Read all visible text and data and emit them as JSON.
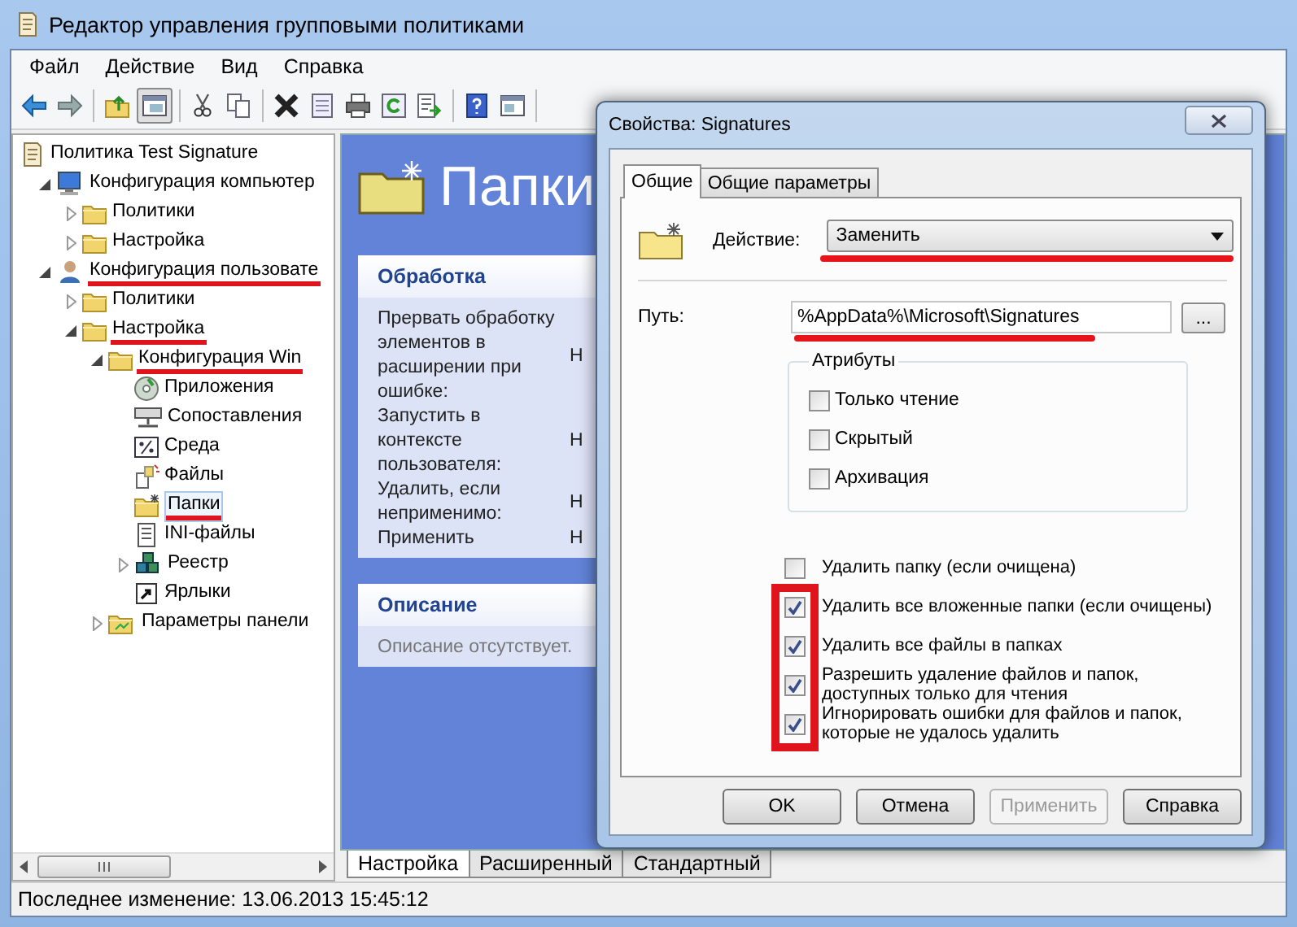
{
  "window": {
    "title": "Редактор управления групповыми политиками"
  },
  "menu": [
    {
      "label": "Файл"
    },
    {
      "label": "Действие"
    },
    {
      "label": "Вид"
    },
    {
      "label": "Справка"
    }
  ],
  "tree": {
    "label": "Политика Test Signature",
    "kind": "policy",
    "selected": false,
    "highlighted": false,
    "children": [
      {
        "label": "Конфигурация компьютер",
        "kind": "computer",
        "expanded": true,
        "selected": false,
        "highlighted": false,
        "children": [
          {
            "label": "Политики",
            "kind": "folder",
            "expanded": false,
            "selected": false,
            "highlighted": false
          },
          {
            "label": "Настройка",
            "kind": "folder",
            "expanded": false,
            "selected": false,
            "highlighted": false
          }
        ]
      },
      {
        "label": "Конфигурация пользовате",
        "kind": "user",
        "expanded": true,
        "selected": false,
        "highlighted": true,
        "children": [
          {
            "label": "Политики",
            "kind": "folder",
            "expanded": false,
            "selected": false,
            "highlighted": false
          },
          {
            "label": "Настройка",
            "kind": "folder",
            "expanded": true,
            "selected": false,
            "highlighted": true,
            "children": [
              {
                "label": "Конфигурация Win",
                "kind": "folder",
                "expanded": true,
                "selected": false,
                "highlighted": true,
                "children": [
                  {
                    "label": "Приложения",
                    "kind": "apps",
                    "selected": false,
                    "highlighted": false
                  },
                  {
                    "label": "Сопоставления",
                    "kind": "mappings",
                    "selected": false,
                    "highlighted": false
                  },
                  {
                    "label": "Среда",
                    "kind": "environment",
                    "selected": false,
                    "highlighted": false
                  },
                  {
                    "label": "Файлы",
                    "kind": "files",
                    "selected": false,
                    "highlighted": false
                  },
                  {
                    "label": "Папки",
                    "kind": "folders",
                    "selected": true,
                    "highlighted": true
                  },
                  {
                    "label": "INI-файлы",
                    "kind": "ini",
                    "selected": false,
                    "highlighted": false
                  },
                  {
                    "label": "Реестр",
                    "kind": "registry",
                    "expanded": false,
                    "selected": false,
                    "highlighted": false
                  },
                  {
                    "label": "Ярлыки",
                    "kind": "shortcuts",
                    "selected": false,
                    "highlighted": false
                  }
                ]
              },
              {
                "label": "Параметры панели",
                "kind": "control-panel",
                "expanded": false,
                "selected": false,
                "highlighted": false
              }
            ]
          }
        ]
      }
    ]
  },
  "details": {
    "heading": "Папки",
    "cards": [
      {
        "title": "Обработка",
        "rows": [
          {
            "label": "Прервать обработку элементов в расширении при ошибке:",
            "value": "Н"
          },
          {
            "label": "Запустить в контексте пользователя:",
            "value": "Н"
          },
          {
            "label": "Удалить, если неприменимо:",
            "value": "Н"
          },
          {
            "label": "Применить",
            "value": "Н"
          }
        ]
      },
      {
        "title": "Описание",
        "text": "Описание отсутствует."
      }
    ]
  },
  "bottom_tabs": [
    {
      "label": "Настройка",
      "selected": true
    },
    {
      "label": "Расширенный",
      "selected": false
    },
    {
      "label": "Стандартный",
      "selected": false
    }
  ],
  "status_bar": {
    "text": "Последнее изменение: 13.06.2013 15:45:12"
  },
  "dialog": {
    "title": "Свойства: Signatures",
    "tabs": [
      {
        "label": "Общие",
        "selected": true
      },
      {
        "label": "Общие параметры",
        "selected": false
      }
    ],
    "action": {
      "label": "Действие:",
      "value": "Заменить",
      "highlighted": true
    },
    "path": {
      "label": "Путь:",
      "value": "%AppData%\\Microsoft\\Signatures",
      "browse": "...",
      "highlighted": true
    },
    "attributes": {
      "title": "Атрибуты",
      "items": [
        {
          "label": "Только чтение",
          "checked": false
        },
        {
          "label": "Скрытый",
          "checked": false
        },
        {
          "label": "Архивация",
          "checked": false
        }
      ]
    },
    "options": [
      {
        "label": "Удалить папку (если очищена)",
        "checked": false,
        "highlighted": false
      },
      {
        "label": "Удалить все вложенные папки (если очищены)",
        "checked": true,
        "highlighted": true
      },
      {
        "label": "Удалить все файлы в папках",
        "checked": true,
        "highlighted": true
      },
      {
        "label": "Разрешить удаление файлов и папок, доступных только для чтения",
        "checked": true,
        "highlighted": true
      },
      {
        "label": "Игнорировать ошибки для файлов и папок, которые не удалось удалить",
        "checked": true,
        "highlighted": true
      }
    ],
    "buttons": [
      {
        "label": "OK",
        "disabled": false
      },
      {
        "label": "Отмена",
        "disabled": false
      },
      {
        "label": "Применить",
        "disabled": true
      },
      {
        "label": "Справка",
        "disabled": false
      }
    ]
  }
}
